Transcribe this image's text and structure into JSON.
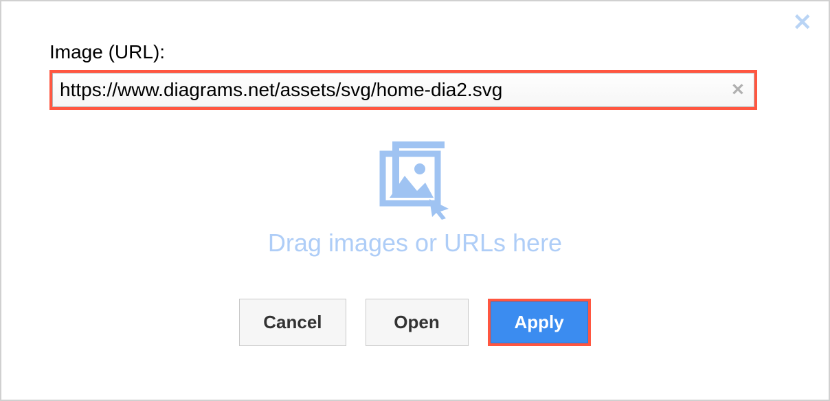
{
  "dialog": {
    "label": "Image (URL):",
    "url_value": "https://www.diagrams.net/assets/svg/home-dia2.svg",
    "drop_text": "Drag images or URLs here"
  },
  "buttons": {
    "cancel": "Cancel",
    "open": "Open",
    "apply": "Apply"
  }
}
